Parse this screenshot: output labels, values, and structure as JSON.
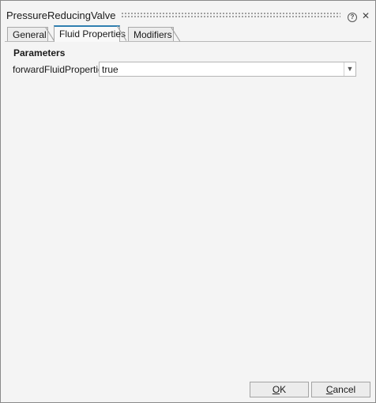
{
  "dialog": {
    "title": "PressureReducingValve",
    "help_icon": "help-circle-icon",
    "close_icon": "close-icon"
  },
  "tabs": [
    {
      "label": "General",
      "active": false
    },
    {
      "label": "Fluid Properties",
      "active": true
    },
    {
      "label": "Modifiers",
      "active": false
    }
  ],
  "parameters": {
    "heading": "Parameters",
    "fields": [
      {
        "label": "forwardFluidProperties",
        "value": "true",
        "icon": "chevron-down-icon"
      }
    ]
  },
  "buttons": {
    "ok": {
      "prefix": "",
      "mnemonic": "O",
      "suffix": "K"
    },
    "cancel": {
      "prefix": "",
      "mnemonic": "C",
      "suffix": "ancel"
    }
  }
}
